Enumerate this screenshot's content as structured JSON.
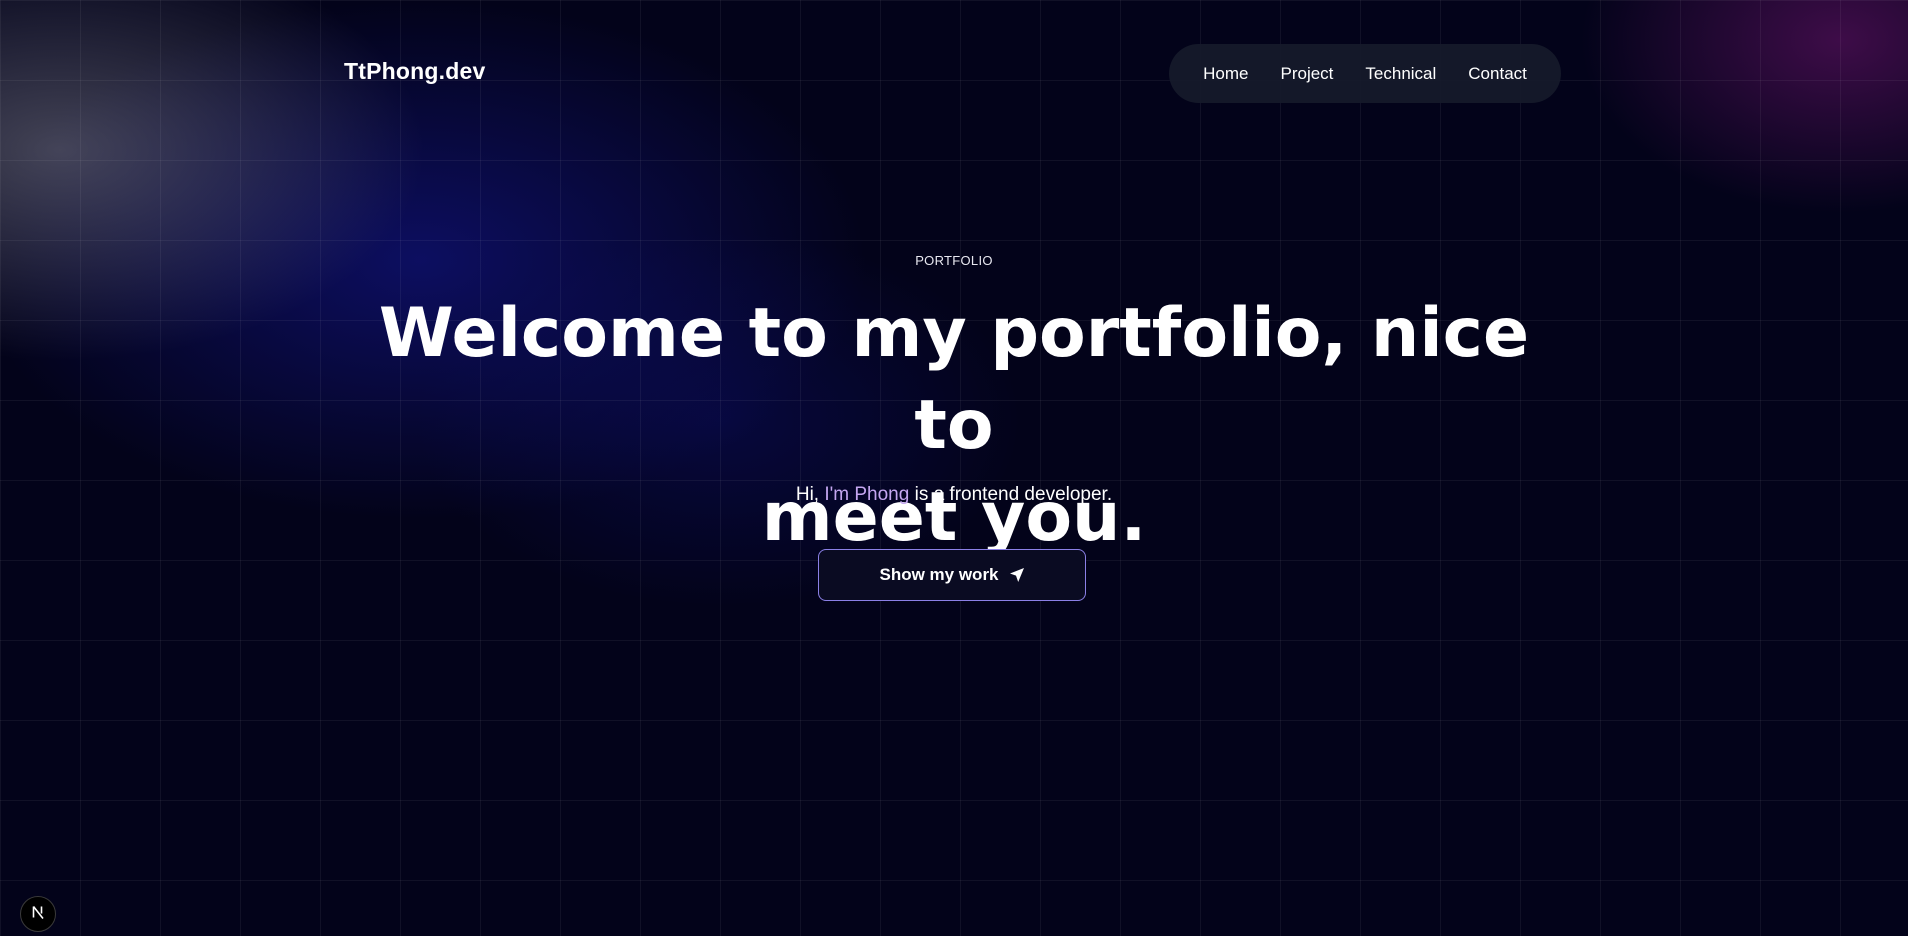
{
  "header": {
    "logo": "TtPhong.dev",
    "nav": [
      {
        "label": "Home"
      },
      {
        "label": "Project"
      },
      {
        "label": "Technical"
      },
      {
        "label": "Contact"
      }
    ]
  },
  "hero": {
    "eyebrow": "PORTFOLIO",
    "headline_line1": "Welcome to my portfolio, nice to",
    "headline_line2": "meet you.",
    "subtitle_prefix": "Hi, ",
    "subtitle_name": "I'm Phong",
    "subtitle_suffix": " is a frontend developer.",
    "cta_label": "Show my work",
    "cta_icon": "send-icon"
  },
  "dev_badge": {
    "letter": "N",
    "icon": "nextjs-icon"
  },
  "colors": {
    "background": "#03031a",
    "accent_text": "#c4a6f0",
    "cta_border": "#8b80e6",
    "nav_background": "#161a2a"
  }
}
